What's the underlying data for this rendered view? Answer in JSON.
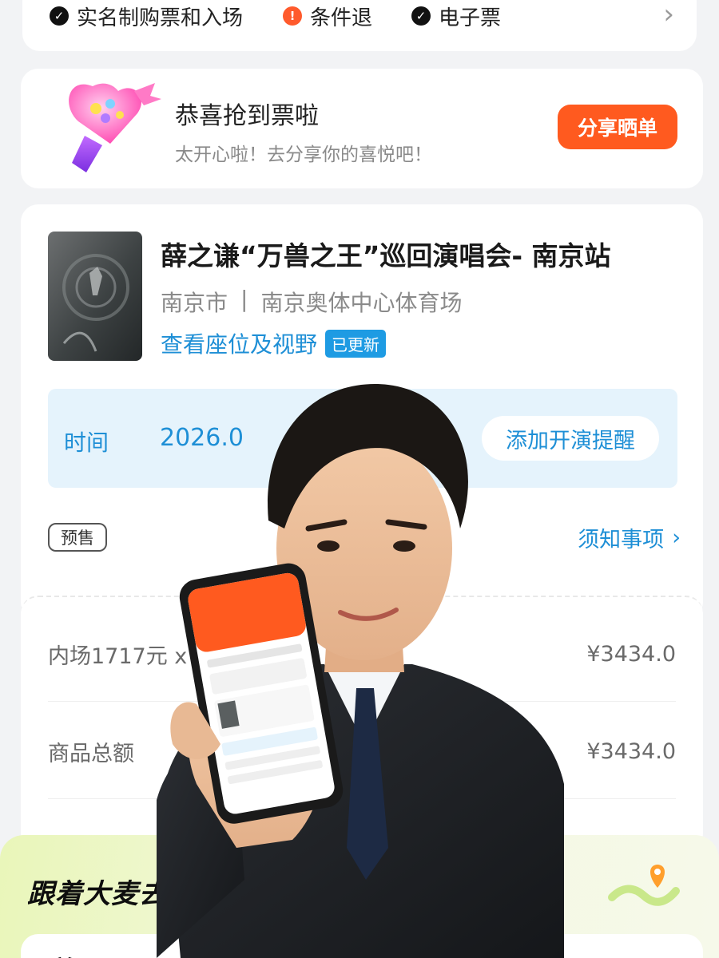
{
  "features": {
    "items": [
      {
        "label": "实名制购票和入场",
        "icon": "check-circle-icon",
        "icon_color": "#111111"
      },
      {
        "label": "条件退",
        "icon": "warning-circle-icon",
        "icon_color": "#ff5a2c"
      },
      {
        "label": "电子票",
        "icon": "check-circle-icon",
        "icon_color": "#111111"
      }
    ]
  },
  "share": {
    "title": "恭喜抢到票啦",
    "subtitle": "太开心啦！去分享你的喜悦吧！",
    "button_label": "分享晒单",
    "button_color": "#ff5a1f"
  },
  "event": {
    "title": "薛之谦“万兽之王”巡回演唱会- 南京站",
    "city": "南京市",
    "separator": "|",
    "venue": "南京奥体中心体育场",
    "seat_link": "查看座位及视野",
    "updated_badge": "已更新",
    "time_label": "时间",
    "time_value": "2026.0",
    "remind_button": "添加开演提醒",
    "presale_badge": "预售",
    "notice_link": "须知事项",
    "accent_color": "#1e8fd6"
  },
  "price": {
    "item_label": "内场1717元 x 2",
    "item_value": "¥3434.0",
    "total_label": "商品总额",
    "total_value": "¥3434.0"
  },
  "promo": {
    "title": "跟着大麦去",
    "next_title": "跟着"
  }
}
